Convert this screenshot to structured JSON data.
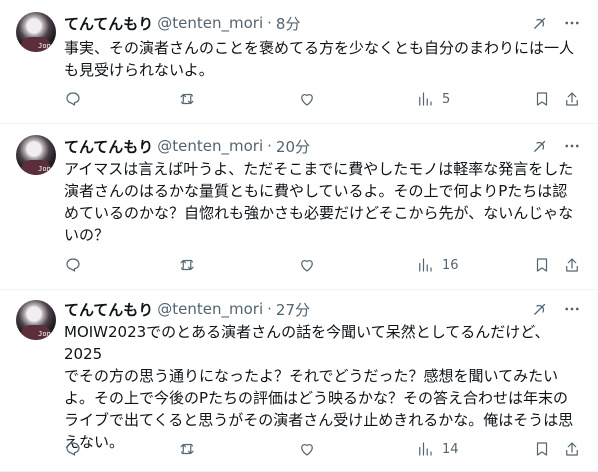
{
  "tweets": [
    {
      "name": "てんてんもり",
      "handle": "@tenten_mori",
      "separator": "·",
      "time": "8分",
      "avatar_label": "Jona",
      "body": "事実、その演者さんのことを褒めてる方を少なくとも自分のまわりには一人\nも見受けられないよ。",
      "views": "5"
    },
    {
      "name": "てんてんもり",
      "handle": "@tenten_mori",
      "separator": "·",
      "time": "20分",
      "avatar_label": "Jona",
      "body": "アイマスは言えば叶うよ、ただそこまでに費やしたモノは軽率な発言をした\n演者さんのはるかな量質ともに費やしているよ。その上で何よりPたちは認\nめているのかな？自惚れも強かさも必要だけどそこから先が、ないんじゃな\nいの？",
      "views": "16"
    },
    {
      "name": "てんてんもり",
      "handle": "@tenten_mori",
      "separator": "·",
      "time": "27分",
      "avatar_label": "Jona",
      "body": "MOIW2023でのとある演者さんの話を今聞いて呆然としてるんだけど、2025\nでその方の思う通りになったよ？それでどうだった？感想を聞いてみたい\nよ。その上で今後のPたちの評価はどう映るかな？その答え合わせは年末の\nライブで出てくると思うがその演者さん受け止めきれるかな。俺はそうは思\nえない。",
      "views": "14"
    }
  ],
  "icons": {
    "top": [
      "grok-icon",
      "more-icon"
    ],
    "actions": [
      "reply-icon",
      "retweet-icon",
      "like-icon",
      "views-icon",
      "bookmark-icon",
      "share-icon"
    ]
  },
  "colors": {
    "text": "#0f1419",
    "secondary": "#536471",
    "divider": "#eff3f4",
    "background": "#ffffff"
  }
}
